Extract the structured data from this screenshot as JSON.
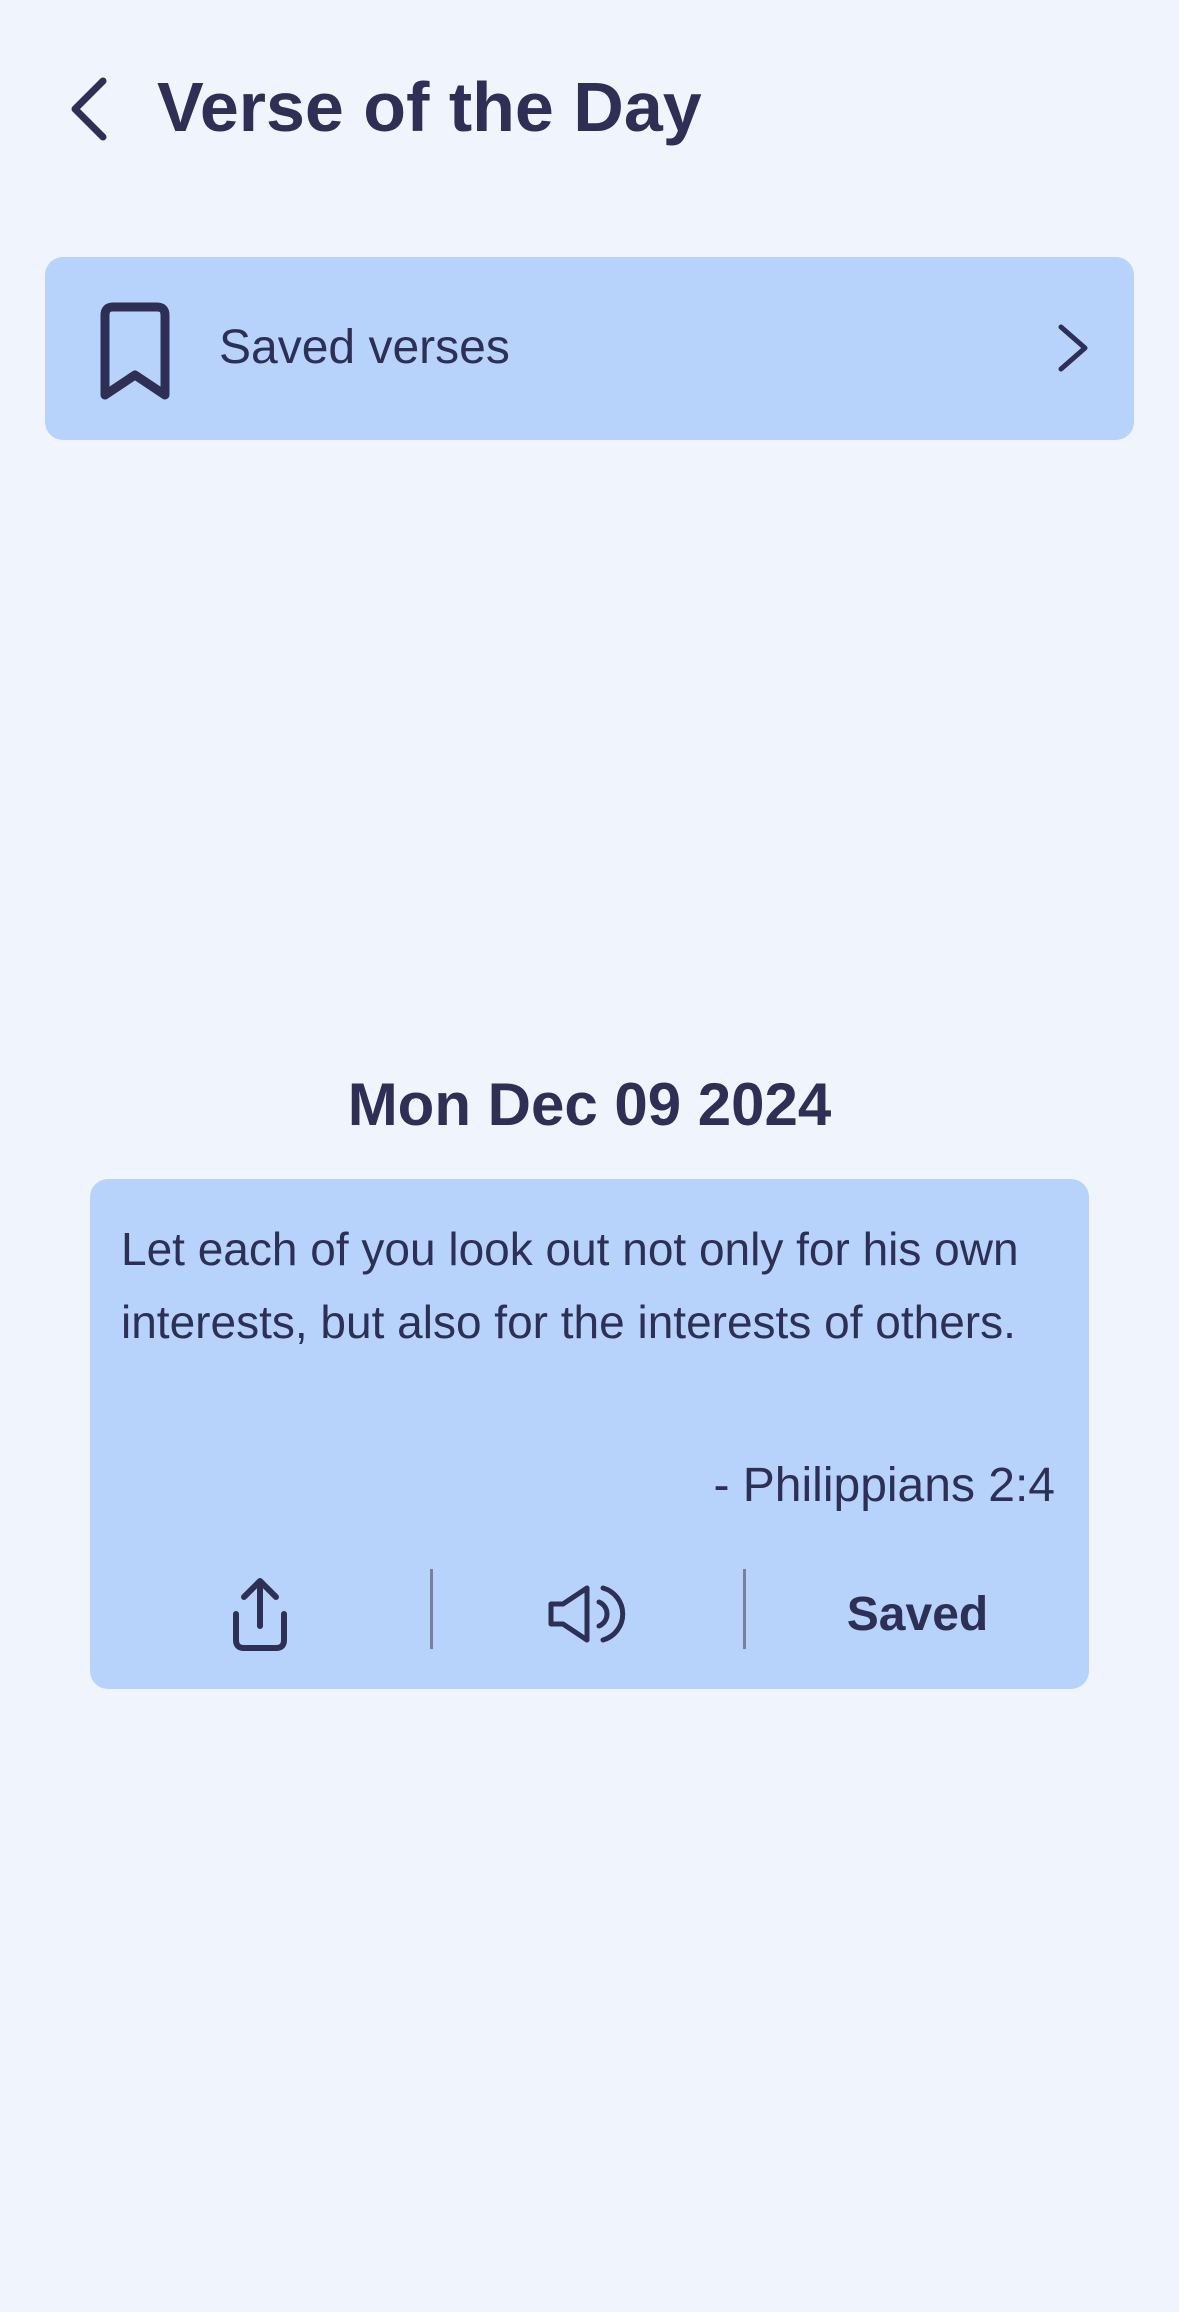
{
  "header": {
    "title": "Verse of the Day",
    "back_icon": "chevron-left-icon"
  },
  "saved_verses_row": {
    "label": "Saved verses",
    "icon": "bookmark-icon",
    "chevron": "chevron-right-icon"
  },
  "date": "Mon Dec 09 2024",
  "verse": {
    "text": "Let each of you look out not only for his own interests, but also for the interests of others.",
    "reference": "- Philippians 2:4"
  },
  "actions": {
    "share_icon": "share-icon",
    "listen_icon": "speaker-icon",
    "saved_label": "Saved"
  },
  "colors": {
    "background": "#f0f5fd",
    "card": "#b7d3fb",
    "text": "#2d2f55",
    "divider": "#7b7f98"
  }
}
